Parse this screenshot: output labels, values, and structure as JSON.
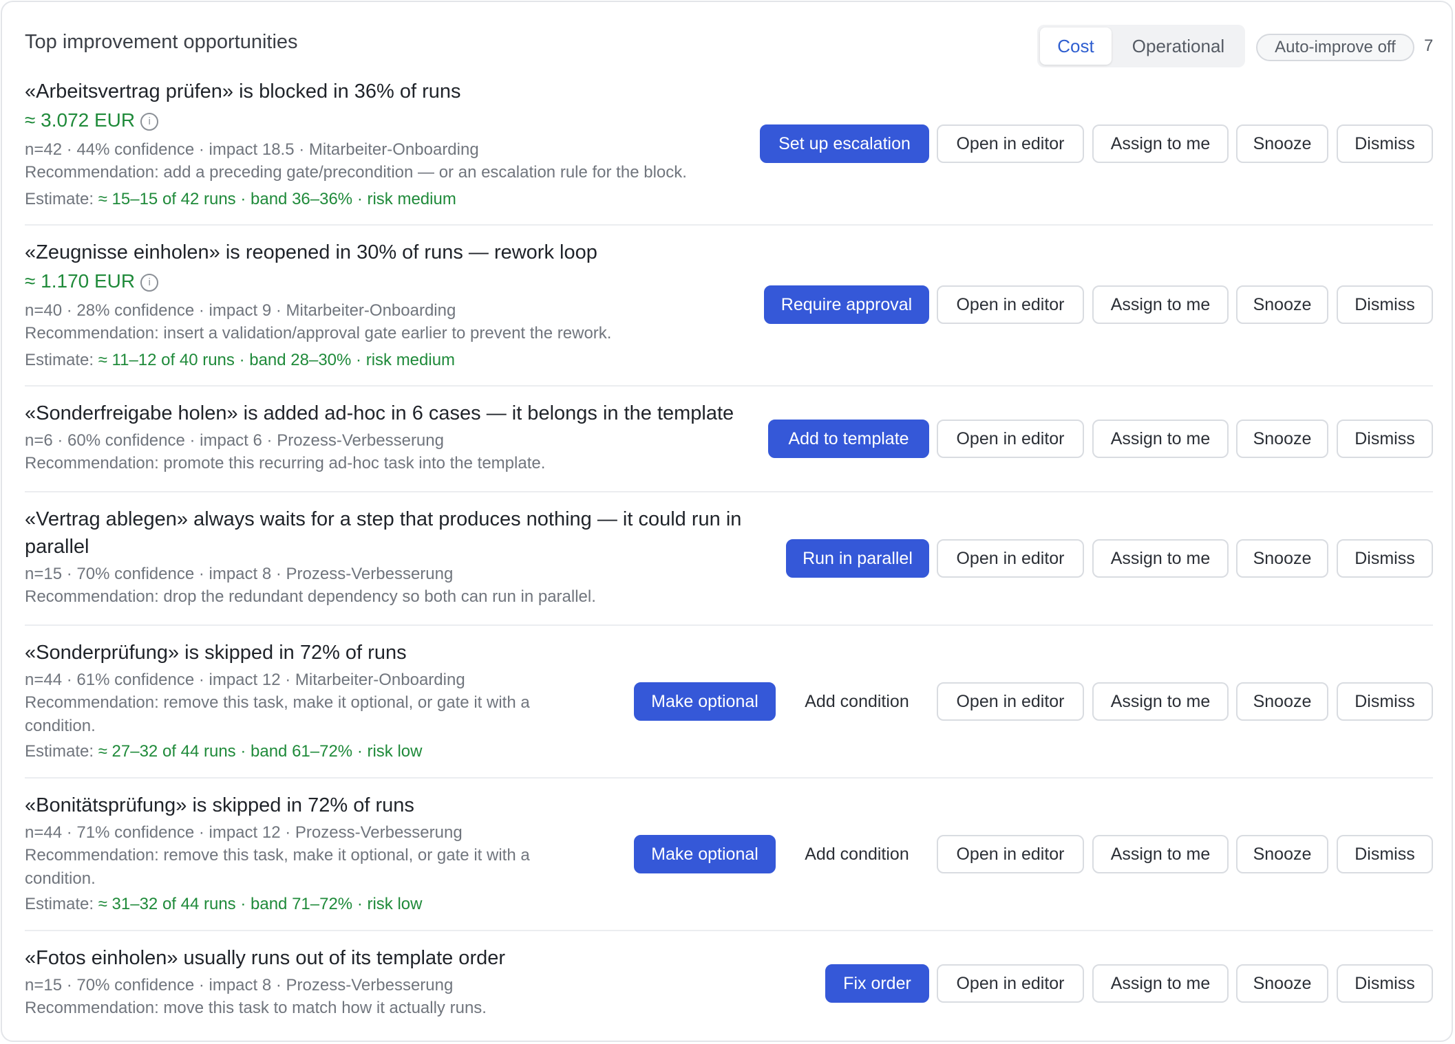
{
  "header": {
    "title": "Top improvement opportunities",
    "tabs": [
      "Cost",
      "Operational"
    ],
    "active_tab": "Cost",
    "auto_improve": "Auto-improve off",
    "count": "7"
  },
  "common": {
    "open_editor": "Open in editor",
    "assign": "Assign to me",
    "snooze": "Snooze",
    "dismiss": "Dismiss",
    "add_condition": "Add condition",
    "info_icon": "i"
  },
  "items": [
    {
      "title": "«Arbeitsvertrag prüfen» is blocked in 36% of runs",
      "money": "≈ 3.072 EUR",
      "meta": "n=42 · 44% confidence · impact 18.5 · Mitarbeiter-Onboarding",
      "recommendation": "Recommendation: add a preceding gate/precondition — or an escalation rule for the block.",
      "estimate_label": "Estimate: ",
      "estimate": "≈ 15–15 of 42 runs · band 36–36% · risk medium",
      "primary": "Set up escalation"
    },
    {
      "title": "«Zeugnisse einholen» is reopened in 30% of runs — rework loop",
      "money": "≈ 1.170 EUR",
      "meta": "n=40 · 28% confidence · impact 9 · Mitarbeiter-Onboarding",
      "recommendation": "Recommendation: insert a validation/approval gate earlier to prevent the rework.",
      "estimate_label": "Estimate: ",
      "estimate": "≈ 11–12 of 40 runs · band 28–30% · risk medium",
      "primary": "Require approval"
    },
    {
      "title": "«Sonderfreigabe holen» is added ad-hoc in 6 cases — it belongs in the template",
      "meta": "n=6 · 60% confidence · impact 6 · Prozess-Verbesserung",
      "recommendation": "Recommendation: promote this recurring ad-hoc task into the template.",
      "primary": "Add to template"
    },
    {
      "title": "«Vertrag ablegen» always waits for a step that produces nothing — it could run in parallel",
      "meta": "n=15 · 70% confidence · impact 8 · Prozess-Verbesserung",
      "recommendation": "Recommendation: drop the redundant dependency so both can run in parallel.",
      "primary": "Run in parallel"
    },
    {
      "title": "«Sonderprüfung» is skipped in 72% of runs",
      "meta": "n=44 · 61% confidence · impact 12 · Mitarbeiter-Onboarding",
      "recommendation": "Recommendation: remove this task, make it optional, or gate it with a condition.",
      "estimate_label": "Estimate: ",
      "estimate": "≈ 27–32 of 44 runs · band 61–72% · risk low",
      "primary": "Make optional"
    },
    {
      "title": "«Bonitätsprüfung» is skipped in 72% of runs",
      "meta": "n=44 · 71% confidence · impact 12 · Prozess-Verbesserung",
      "recommendation": "Recommendation: remove this task, make it optional, or gate it with a condition.",
      "estimate_label": "Estimate: ",
      "estimate": "≈ 31–32 of 44 runs · band 71–72% · risk low",
      "primary": "Make optional"
    },
    {
      "title": "«Fotos einholen» usually runs out of its template order",
      "meta": "n=15 · 70% confidence · impact 8 · Prozess-Verbesserung",
      "recommendation": "Recommendation: move this task to match how it actually runs.",
      "primary": "Fix order"
    }
  ]
}
